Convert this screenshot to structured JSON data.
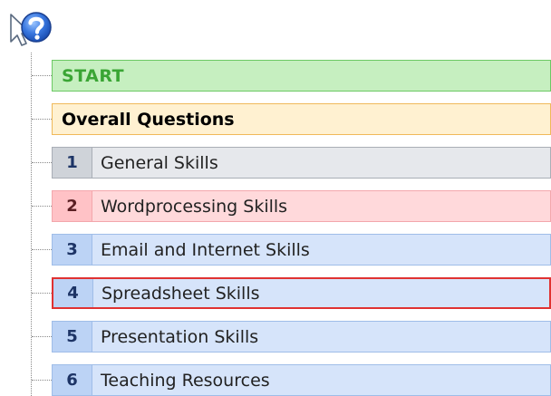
{
  "help": {
    "icon": "help-question-cursor-icon"
  },
  "start": {
    "label": "START"
  },
  "overall": {
    "label": "Overall Questions"
  },
  "skills": [
    {
      "number": "1",
      "label": "General Skills",
      "color": "#cfd3d9"
    },
    {
      "number": "2",
      "label": "Wordprocessing Skills",
      "color": "#ffc2c6"
    },
    {
      "number": "3",
      "label": "Email and Internet Skills",
      "color": "#bcd3f5"
    },
    {
      "number": "4",
      "label": "Spreadsheet Skills",
      "color": "#bcd3f5",
      "outline": "#e03232"
    },
    {
      "number": "5",
      "label": "Presentation Skills",
      "color": "#bcd3f5"
    },
    {
      "number": "6",
      "label": "Teaching Resources",
      "color": "#bcd3f5"
    }
  ]
}
